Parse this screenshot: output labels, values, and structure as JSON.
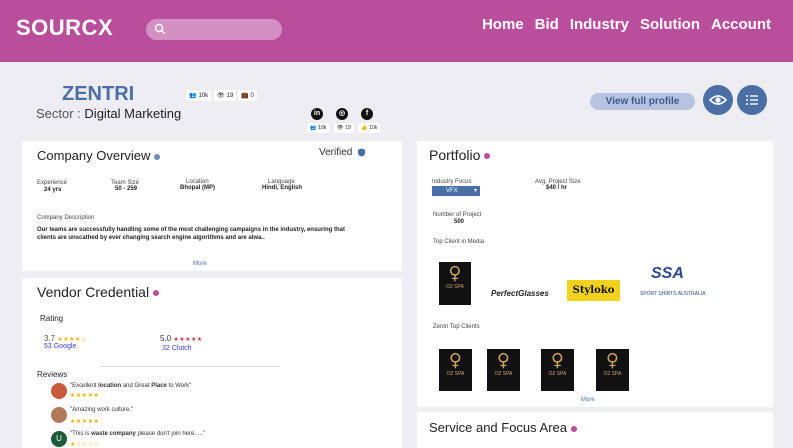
{
  "header": {
    "logo": "SOURCX",
    "nav": [
      "Home",
      "Bid",
      "Industry",
      "Solution",
      "Account"
    ]
  },
  "profile": {
    "name": "ZENTRI",
    "sector_label": "Sector :",
    "sector_value": "Digital Marketing",
    "stats": [
      {
        "icon": "people-icon",
        "value": "10k"
      },
      {
        "icon": "eye-icon",
        "value": "19"
      },
      {
        "icon": "briefcase-icon",
        "value": "0"
      }
    ],
    "socials": [
      {
        "icon": "linkedin-icon",
        "glyph": "in",
        "stats": [
          {
            "icon": "people-icon",
            "value": "10k"
          },
          {
            "icon": "eye-icon",
            "value": "19"
          },
          {
            "icon": "like-icon",
            "value": "10k"
          }
        ]
      },
      {
        "icon": "instagram-icon",
        "glyph": "◎"
      },
      {
        "icon": "facebook-icon",
        "glyph": "f"
      }
    ],
    "view_full_profile": "View full profile"
  },
  "overview": {
    "title": "Company Overview",
    "verified": "Verified",
    "fields": [
      {
        "label": "Experience",
        "value": "24 yrs"
      },
      {
        "label": "Team Size",
        "value": "50 - 259"
      },
      {
        "label": "Location",
        "value": "Bhopal (MP)"
      },
      {
        "label": "Language",
        "value": "Hindi, English"
      }
    ],
    "description_label": "Company Description",
    "description": "Our teams are successfully handling some of the most challenging campaigns in the industry, ensuring that clients are unscathed by ever changing search engine algorithms and are alwa..",
    "more": "More"
  },
  "vendor": {
    "title": "Vendor Credential",
    "rating_label": "Rating",
    "google_score": "3.7",
    "google_count": "53 Google",
    "clutch_score": "5.0",
    "clutch_count": "32 Clutch",
    "reviews_label": "Reviews",
    "reviews": [
      {
        "pre": "\"Excellent ",
        "b1": "location",
        "mid": " and Great ",
        "b2": "Place",
        "post": " to Work\"",
        "stars": "★★★★★",
        "avatar_color": "#c85a3c",
        "initial": ""
      },
      {
        "pre": "\"Amazing work culture.\"",
        "b1": "",
        "mid": "",
        "b2": "",
        "post": "",
        "stars": "★★★★★",
        "avatar_color": "#b07a5a",
        "initial": ""
      },
      {
        "pre": "\"This is ",
        "b1": "waste company",
        "mid": " please don't join here.....\"",
        "b2": "",
        "post": "",
        "stars": "★☆☆☆☆",
        "avatar_color": "#1e5a3c",
        "initial": "U"
      }
    ]
  },
  "portfolio": {
    "title": "Portfolio",
    "industry_focus_label": "Industry Focus",
    "industry_focus_value": "VFX",
    "avg_project_label": "Avg. Project Size",
    "avg_project_value": "$40 / hr",
    "num_project_label": "Number of Project",
    "num_project_value": "500",
    "top_client_media_label": "Top Client in Media",
    "media_clients": [
      {
        "type": "o2",
        "text": "O2 SPA"
      },
      {
        "type": "perfect",
        "text": "PerfectGlasses"
      },
      {
        "type": "styloko",
        "text": "Styloko"
      },
      {
        "type": "ssa",
        "text": "SSA",
        "sub": "SPORT SHIRTS AUSTRALIA"
      }
    ],
    "top_clients_label": "Zentri Top Clients",
    "top_clients": [
      "O2 SPA",
      "O2 SPA",
      "O2 SPA",
      "O2 SPA"
    ],
    "more": "More"
  },
  "service": {
    "title": "Service and Focus Area"
  },
  "colors": {
    "header": "#b94f9c",
    "accent_blue": "#4a6fa5",
    "dot": "#b94f9c"
  }
}
